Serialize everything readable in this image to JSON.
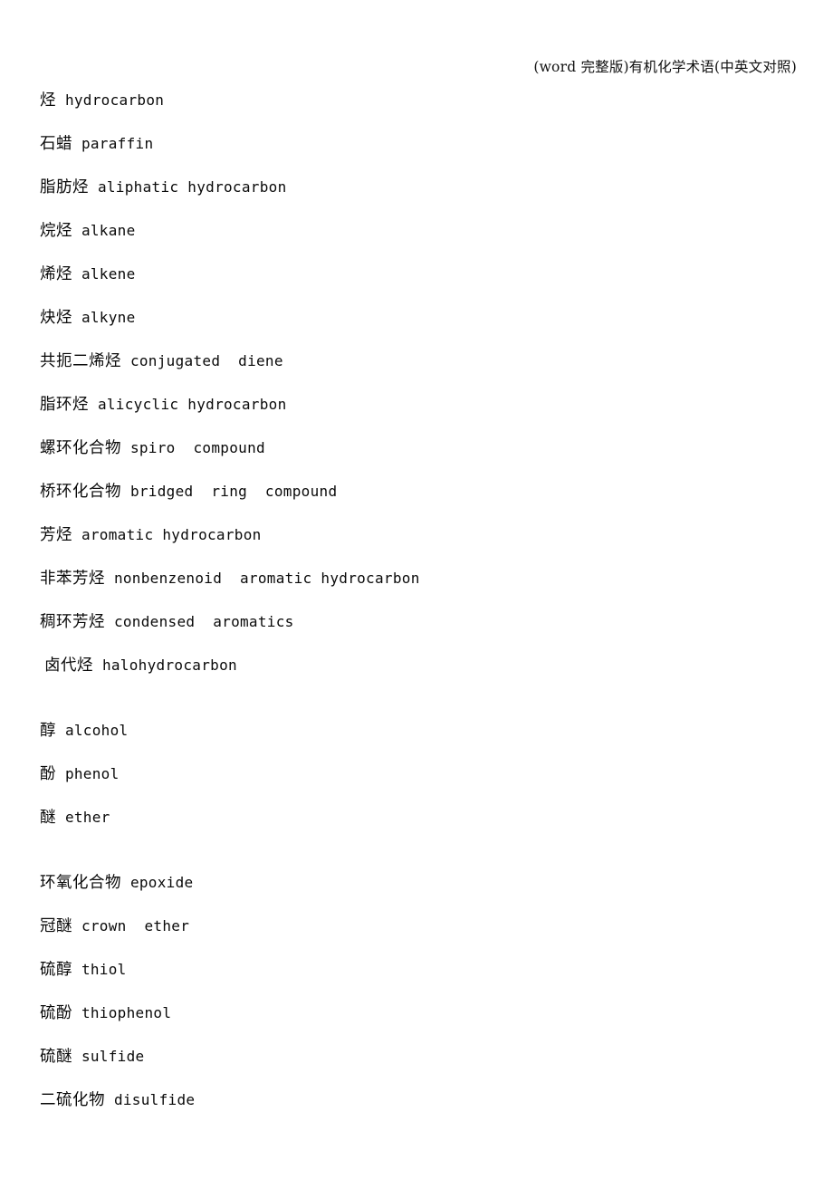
{
  "document": {
    "header": "(word 完整版)有机化学术语(中英文对照)",
    "page_background": "#ffffff",
    "text_color": "#0a0a0a"
  },
  "glossary": {
    "entries": [
      {
        "zh": "烃",
        "sep": " ",
        "en": "hydrocarbon",
        "gap_before": false,
        "indent": false
      },
      {
        "zh": "石蜡",
        "sep": " ",
        "en": "paraffin",
        "gap_before": false,
        "indent": false
      },
      {
        "zh": "脂肪烃",
        "sep": " ",
        "en": "aliphatic hydrocarbon",
        "gap_before": false,
        "indent": false
      },
      {
        "zh": "烷烃",
        "sep": " ",
        "en": "alkane",
        "gap_before": false,
        "indent": false
      },
      {
        "zh": "烯烃",
        "sep": " ",
        "en": "alkene",
        "gap_before": false,
        "indent": false
      },
      {
        "zh": "炔烃",
        "sep": " ",
        "en": "alkyne",
        "gap_before": false,
        "indent": false
      },
      {
        "zh": "共扼二烯烃",
        "sep": " ",
        "en": "conjugated  diene",
        "gap_before": false,
        "indent": false
      },
      {
        "zh": "脂环烃",
        "sep": " ",
        "en": "alicyclic hydrocarbon",
        "gap_before": false,
        "indent": false
      },
      {
        "zh": "螺环化合物",
        "sep": " ",
        "en": "spiro  compound",
        "gap_before": false,
        "indent": false
      },
      {
        "zh": "桥环化合物",
        "sep": " ",
        "en": "bridged  ring  compound",
        "gap_before": false,
        "indent": false
      },
      {
        "zh": "芳烃",
        "sep": " ",
        "en": "aromatic hydrocarbon",
        "gap_before": false,
        "indent": false
      },
      {
        "zh": "非苯芳烃",
        "sep": " ",
        "en": "nonbenzenoid  aromatic hydrocarbon",
        "gap_before": false,
        "indent": false
      },
      {
        "zh": "稠环芳烃",
        "sep": " ",
        "en": "condensed  aromatics",
        "gap_before": false,
        "indent": false
      },
      {
        "zh": "卤代烃",
        "sep": " ",
        "en": "halohydrocarbon",
        "gap_before": false,
        "indent": true
      },
      {
        "zh": "醇",
        "sep": " ",
        "en": "alcohol",
        "gap_before": true,
        "indent": false
      },
      {
        "zh": "酚",
        "sep": " ",
        "en": "phenol",
        "gap_before": false,
        "indent": false
      },
      {
        "zh": "醚",
        "sep": " ",
        "en": "ether",
        "gap_before": false,
        "indent": false
      },
      {
        "zh": "环氧化合物",
        "sep": " ",
        "en": "epoxide",
        "gap_before": true,
        "indent": false
      },
      {
        "zh": "冠醚",
        "sep": " ",
        "en": "crown  ether",
        "gap_before": false,
        "indent": false
      },
      {
        "zh": "硫醇",
        "sep": " ",
        "en": "thiol",
        "gap_before": false,
        "indent": false
      },
      {
        "zh": "硫酚",
        "sep": " ",
        "en": "thiophenol",
        "gap_before": false,
        "indent": false
      },
      {
        "zh": "硫醚",
        "sep": " ",
        "en": "sulfide",
        "gap_before": false,
        "indent": false
      },
      {
        "zh": "二硫化物",
        "sep": " ",
        "en": "disulfide",
        "gap_before": false,
        "indent": false
      }
    ]
  }
}
